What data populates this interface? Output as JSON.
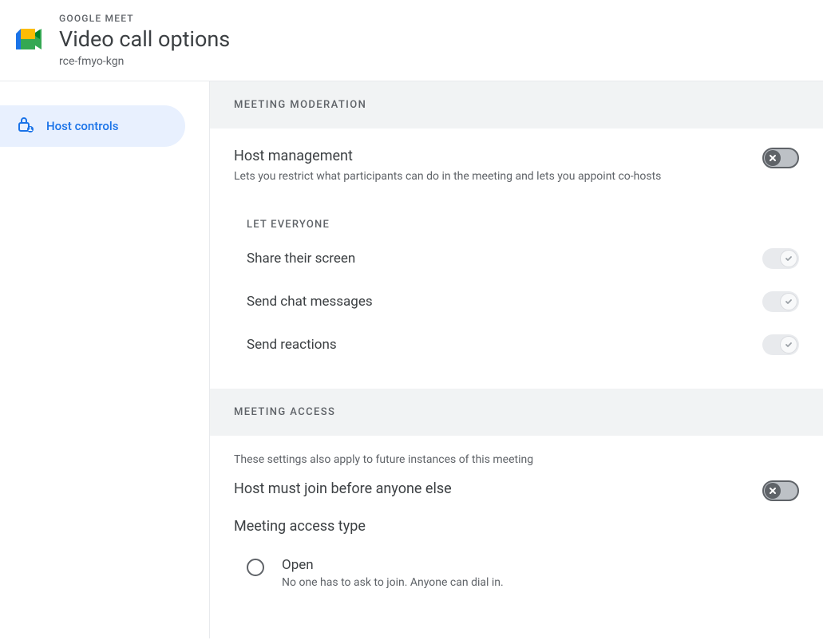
{
  "header": {
    "app_name": "GOOGLE MEET",
    "page_title": "Video call options",
    "meeting_code": "rce-fmyo-kgn"
  },
  "sidebar": {
    "items": [
      {
        "label": "Host controls"
      }
    ]
  },
  "moderation": {
    "section_title": "MEETING MODERATION",
    "host_management": {
      "title": "Host management",
      "description": "Lets you restrict what participants can do in the meeting and lets you appoint co-hosts"
    },
    "let_everyone_label": "LET EVERYONE",
    "options": {
      "share_screen": "Share their screen",
      "send_chat": "Send chat messages",
      "send_reactions": "Send reactions"
    }
  },
  "access": {
    "section_title": "MEETING ACCESS",
    "note": "These settings also apply to future instances of this meeting",
    "host_must_join": "Host must join before anyone else",
    "access_type_title": "Meeting access type",
    "open": {
      "label": "Open",
      "description": "No one has to ask to join. Anyone can dial in."
    }
  }
}
